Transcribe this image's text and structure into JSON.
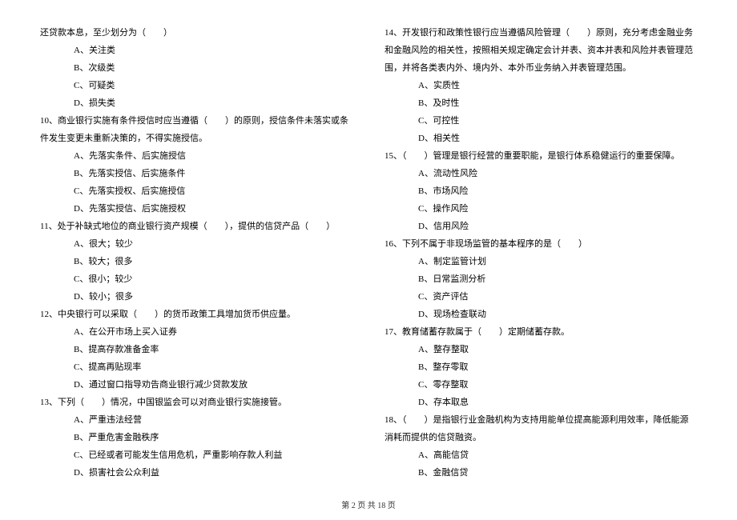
{
  "left": {
    "q9_cont": "还贷款本息，至少划分为（　　）",
    "q9_opts": [
      "A、关注类",
      "B、次级类",
      "C、可疑类",
      "D、损失类"
    ],
    "q10": "10、商业银行实施有条件授信时应当遵循（　　）的原则，授信条件未落实或条件发生变更未重新决策的，不得实施授信。",
    "q10_opts": [
      "A、先落实条件、后实施授信",
      "B、先落实授信、后实施条件",
      "C、先落实授权、后实施授信",
      "D、先落实授信、后实施授权"
    ],
    "q11": "11、处于补缺式地位的商业银行资产规模（　　），提供的信贷产品（　　）",
    "q11_opts": [
      "A、很大；较少",
      "B、较大；很多",
      "C、很小；较少",
      "D、较小；很多"
    ],
    "q12": "12、中央银行可以采取（　　）的货币政策工具增加货币供应量。",
    "q12_opts": [
      "A、在公开市场上买入证券",
      "B、提高存款准备金率",
      "C、提高再贴现率",
      "D、通过窗口指导劝告商业银行减少贷款发放"
    ],
    "q13": "13、下列（　　）情况，中国银监会可以对商业银行实施接管。",
    "q13_opts": [
      "A、严重违法经营",
      "B、严重危害金融秩序",
      "C、已经或者可能发生信用危机，严重影响存款人利益",
      "D、损害社会公众利益"
    ]
  },
  "right": {
    "q14": "14、开发银行和政策性银行应当遵循风险管理（　　）原则，充分考虑金融业务和金融风险的相关性，按照相关规定确定会计并表、资本并表和风险并表管理范围，并将各类表内外、境内外、本外币业务纳入并表管理范围。",
    "q14_opts": [
      "A、实质性",
      "B、及时性",
      "C、可控性",
      "D、相关性"
    ],
    "q15": "15、（　　）管理是银行经营的重要职能，是银行体系稳健运行的重要保障。",
    "q15_opts": [
      "A、流动性风险",
      "B、市场风险",
      "C、操作风险",
      "D、信用风险"
    ],
    "q16": "16、下列不属于非现场监管的基本程序的是（　　）",
    "q16_opts": [
      "A、制定监管计划",
      "B、日常监测分析",
      "C、资产评估",
      "D、现场检查联动"
    ],
    "q17": "17、教育储蓄存款属于（　　）定期储蓄存款。",
    "q17_opts": [
      "A、整存整取",
      "B、整存零取",
      "C、零存整取",
      "D、存本取息"
    ],
    "q18": "18、（　　）是指银行业金融机构为支持用能单位提高能源利用效率，降低能源消耗而提供的信贷融资。",
    "q18_opts": [
      "A、高能信贷",
      "B、金融信贷"
    ]
  },
  "footer": "第 2 页 共 18 页"
}
